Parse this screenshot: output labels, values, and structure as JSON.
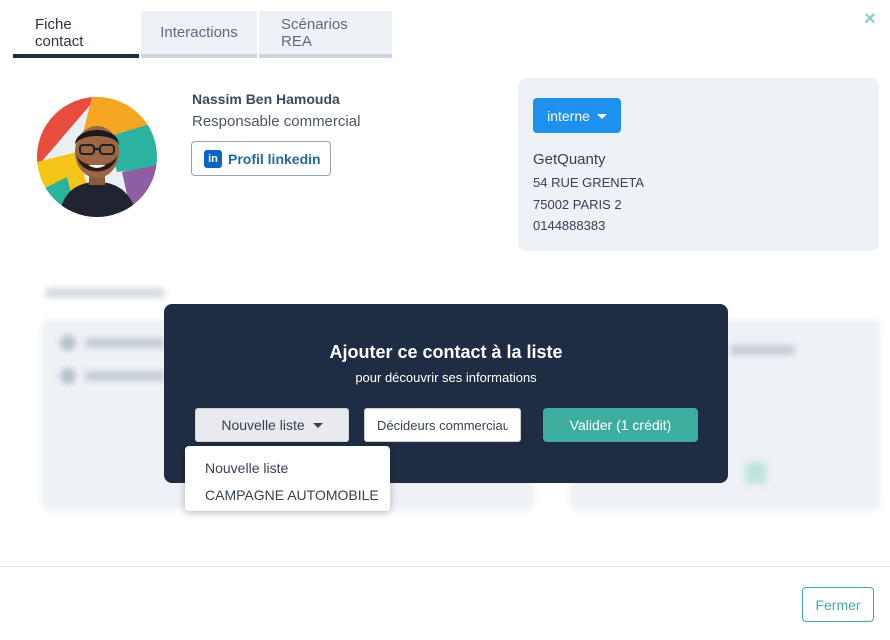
{
  "tabs": [
    {
      "label": "Fiche contact",
      "active": true
    },
    {
      "label": "Interactions",
      "active": false
    },
    {
      "label": "Scénarios REA",
      "active": false
    }
  ],
  "close_icon": "×",
  "contact": {
    "name": "Nassim Ben Hamouda",
    "role": "Responsable commercial",
    "linkedin_label": "Profil linkedin",
    "linkedin_icon": "in"
  },
  "company": {
    "type_label": "interne",
    "name": "GetQuanty",
    "address": "54 RUE GRENETA",
    "city": "75002 PARIS 2",
    "phone": "0144888383"
  },
  "modal": {
    "title": "Ajouter ce contact à la liste",
    "subtitle": "pour découvrir ses informations",
    "select_label": "Nouvelle liste",
    "input_value": "Décideurs commerciaux",
    "validate_label": "Valider (1 crédit)"
  },
  "dropdown": {
    "options": [
      "Nouvelle liste",
      "CAMPAGNE AUTOMOBILE"
    ]
  },
  "footer": {
    "close_label": "Fermer"
  },
  "colors": {
    "accent": "#3dada0",
    "primary_blue": "#1e90f0",
    "modal_bg": "#1f2d44"
  }
}
